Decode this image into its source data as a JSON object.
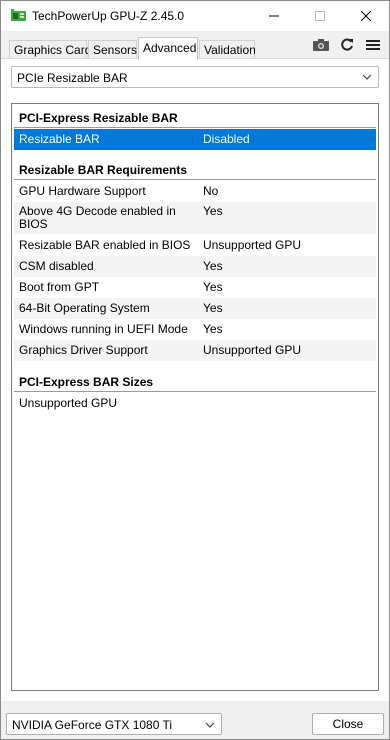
{
  "window": {
    "title": "TechPowerUp GPU-Z 2.45.0",
    "icons": {
      "app": "gpuz-app-icon",
      "minimize": "minimize-icon",
      "maximize": "maximize-icon",
      "close": "close-icon"
    }
  },
  "tabs": [
    {
      "label": "Graphics Card"
    },
    {
      "label": "Sensors"
    },
    {
      "label": "Advanced",
      "active": true
    },
    {
      "label": "Validation"
    }
  ],
  "toolbar": {
    "icons": [
      "camera-icon",
      "refresh-icon",
      "menu-icon"
    ]
  },
  "category_select": {
    "value": "PCIe Resizable BAR"
  },
  "sections": {
    "rebar": {
      "header": "PCI-Express Resizable BAR",
      "rows": [
        {
          "label": "Resizable BAR",
          "value": "Disabled"
        }
      ]
    },
    "requirements": {
      "header": "Resizable BAR Requirements",
      "rows": [
        {
          "label": "GPU Hardware Support",
          "value": "No"
        },
        {
          "label": "Above 4G Decode enabled in BIOS",
          "value": "Yes"
        },
        {
          "label": "Resizable BAR enabled in BIOS",
          "value": "Unsupported GPU"
        },
        {
          "label": "CSM disabled",
          "value": "Yes"
        },
        {
          "label": "Boot from GPT",
          "value": "Yes"
        },
        {
          "label": "64-Bit Operating System",
          "value": "Yes"
        },
        {
          "label": "Windows running in UEFI Mode",
          "value": "Yes"
        },
        {
          "label": "Graphics Driver Support",
          "value": "Unsupported GPU"
        }
      ]
    },
    "bar_sizes": {
      "header": "PCI-Express BAR Sizes",
      "rows": [
        {
          "label": "Unsupported GPU",
          "value": ""
        }
      ]
    }
  },
  "footer": {
    "gpu_select": "NVIDIA GeForce GTX 1080 Ti",
    "close_label": "Close"
  },
  "colors": {
    "selection": "#0078d7",
    "app_icon_green": "#3aa844"
  }
}
